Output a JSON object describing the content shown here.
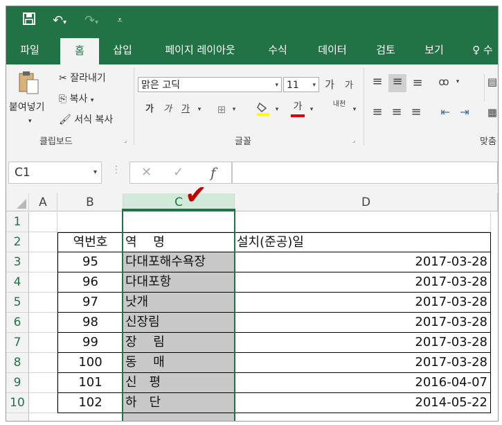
{
  "qat": {
    "save_icon": "save-icon",
    "undo_icon": "undo-icon",
    "redo_icon": "redo-icon",
    "customize_icon": "customize-icon"
  },
  "tabs": [
    "파일",
    "홈",
    "삽입",
    "페이지 레이아웃",
    "수식",
    "데이터",
    "검토",
    "보기",
    "수"
  ],
  "ribbon": {
    "clipboard": {
      "paste": "붙여넣기",
      "cut": "잘라내기",
      "copy": "복사",
      "format_painter": "서식 복사",
      "label": "클립보드"
    },
    "font": {
      "name": "맑은 고딕",
      "size": "11",
      "grow": "가",
      "shrink": "가",
      "bold": "가",
      "italic": "가",
      "underline": "가",
      "font_color": "가",
      "phonetic": "내천",
      "label": "글꼴"
    },
    "alignment": {
      "label": "맞춤"
    }
  },
  "formula_bar": {
    "name_box": "C1",
    "cancel": "✕",
    "enter": "✓",
    "fx": "f"
  },
  "columns": [
    "A",
    "B",
    "C",
    "D"
  ],
  "rows": [
    {
      "num": "1",
      "b": "",
      "c": "",
      "d": ""
    },
    {
      "num": "2",
      "b": "역번호",
      "c": "역　 명",
      "d": "설치(준공)일"
    },
    {
      "num": "3",
      "b": "95",
      "c": " 다대포해수욕장",
      "d": "2017-03-28"
    },
    {
      "num": "4",
      "b": "96",
      "c": "다대포항",
      "d": "2017-03-28"
    },
    {
      "num": "5",
      "b": "97",
      "c": "낫개",
      "d": "2017-03-28"
    },
    {
      "num": "6",
      "b": "98",
      "c": " 신장림",
      "d": "2017-03-28"
    },
    {
      "num": "7",
      "b": "99",
      "c": "장　 림",
      "d": "2017-03-28"
    },
    {
      "num": "8",
      "b": "100",
      "c": "동　 매",
      "d": "2017-03-28"
    },
    {
      "num": "9",
      "b": "101",
      "c": "신　평",
      "d": "2016-04-07"
    },
    {
      "num": "10",
      "b": "102",
      "c": "하　단",
      "d": "2014-05-22"
    }
  ],
  "accent_color": "#217346",
  "annotation_mark": "✔"
}
